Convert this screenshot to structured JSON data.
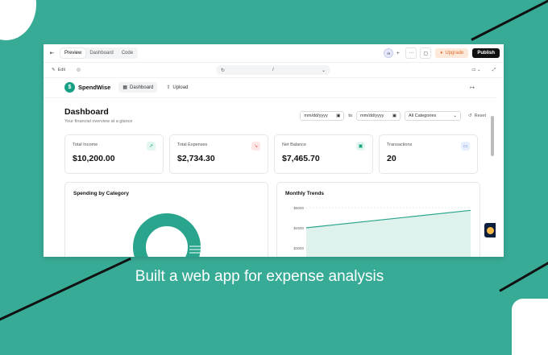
{
  "editor": {
    "tabs": [
      "Preview",
      "Dashboard",
      "Code"
    ],
    "avatar_initial": "AI",
    "upgrade_label": "Upgrade",
    "publish_label": "Publish",
    "edit_label": "Edit",
    "url_value": "/"
  },
  "app": {
    "brand": "SpendWise",
    "logo_letter": "$",
    "nav": [
      "Dashboard",
      "Upload"
    ],
    "title": "Dashboard",
    "subtitle": "Your financial overview at a glance",
    "date_from_placeholder": "mm/dd/yyyy",
    "to_label": "to",
    "date_to_placeholder": "mm/dd/yyyy",
    "category_value": "All Categories",
    "reset_label": "Reset",
    "stats": [
      {
        "label": "Total Income",
        "value": "$10,200.00",
        "icon": "trend-up-icon",
        "color": "#18a37f"
      },
      {
        "label": "Total Expenses",
        "value": "$2,734.30",
        "icon": "trend-down-icon",
        "color": "#e25b5b"
      },
      {
        "label": "Net Balance",
        "value": "$7,465.70",
        "icon": "wallet-icon",
        "color": "#18a37f"
      },
      {
        "label": "Transactions",
        "value": "20",
        "icon": "card-icon",
        "color": "#4a78e8"
      }
    ],
    "spending_title": "Spending by Category",
    "trends_title": "Monthly Trends"
  },
  "chart_data": {
    "type": "area",
    "title": "Monthly Trends",
    "y_ticks": [
      "$6000",
      "$4500",
      "$3000"
    ],
    "series": [
      {
        "values": [
          4500,
          5800
        ]
      }
    ],
    "color": "#2aa58d"
  },
  "caption": "Built a web app for expense analysis"
}
